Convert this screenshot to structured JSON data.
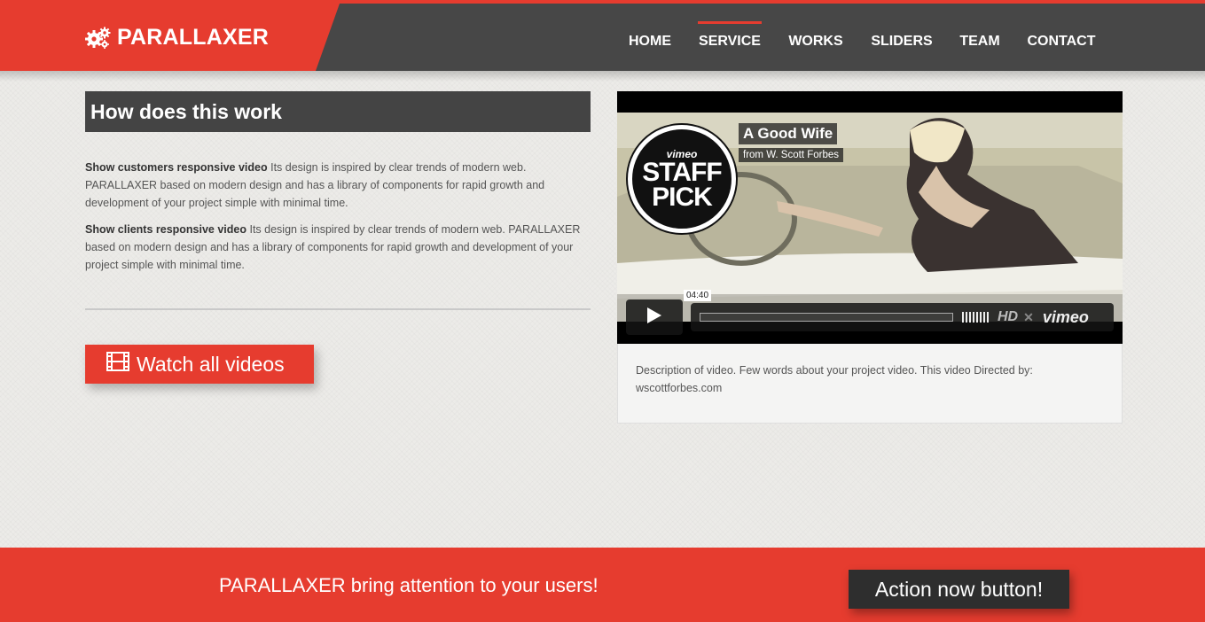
{
  "brand": {
    "name": "PARALLAXER",
    "icon": "gears-icon"
  },
  "nav": {
    "items": [
      {
        "label": "HOME",
        "active": false
      },
      {
        "label": "SERVICE",
        "active": true
      },
      {
        "label": "WORKS",
        "active": false
      },
      {
        "label": "SLIDERS",
        "active": false
      },
      {
        "label": "TEAM",
        "active": false
      },
      {
        "label": "CONTACT",
        "active": false
      }
    ]
  },
  "section": {
    "title": "How does this work",
    "paragraphs": [
      {
        "bold": "Show customers responsive video",
        "text": " Its design is inspired by clear trends of modern web. PARALLAXER based on modern design and has a library of components for rapid growth and development of your project simple with minimal time."
      },
      {
        "bold": "Show clients responsive video",
        "text": " Its design is inspired by clear trends of modern web. PARALLAXER based on modern design and has a library of components for rapid growth and development of your project simple with minimal time."
      }
    ],
    "watch_button": {
      "label": "Watch all videos",
      "icon": "film-icon"
    }
  },
  "video": {
    "badge": {
      "brand": "vimeo",
      "text1": "STAFF",
      "text2": "PICK"
    },
    "title": "A Good Wife",
    "byline": "from W. Scott Forbes",
    "timecode": "04:40",
    "hd": "HD",
    "player_brand": "vimeo",
    "description": "Description of video. Few words about your project video. This video Directed by: wscottforbes.com"
  },
  "cta": {
    "text": "PARALLAXER bring attention to your users!",
    "button": "Action now button!"
  },
  "colors": {
    "accent": "#e63c2f",
    "dark": "#474747",
    "background": "#ecebe8"
  }
}
